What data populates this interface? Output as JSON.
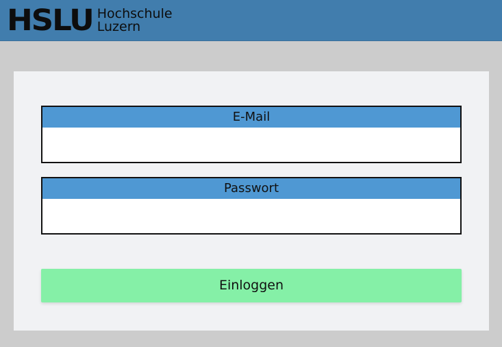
{
  "header": {
    "logo_mark": "HSLU",
    "logo_line1": "Hochschule",
    "logo_line2": "Luzern",
    "background_color": "#417dad"
  },
  "form": {
    "email_label": "E-Mail",
    "email_value": "",
    "password_label": "Passwort",
    "password_value": "",
    "login_button": "Einloggen",
    "label_color": "#4f98d3",
    "button_color": "#85f0a7"
  }
}
